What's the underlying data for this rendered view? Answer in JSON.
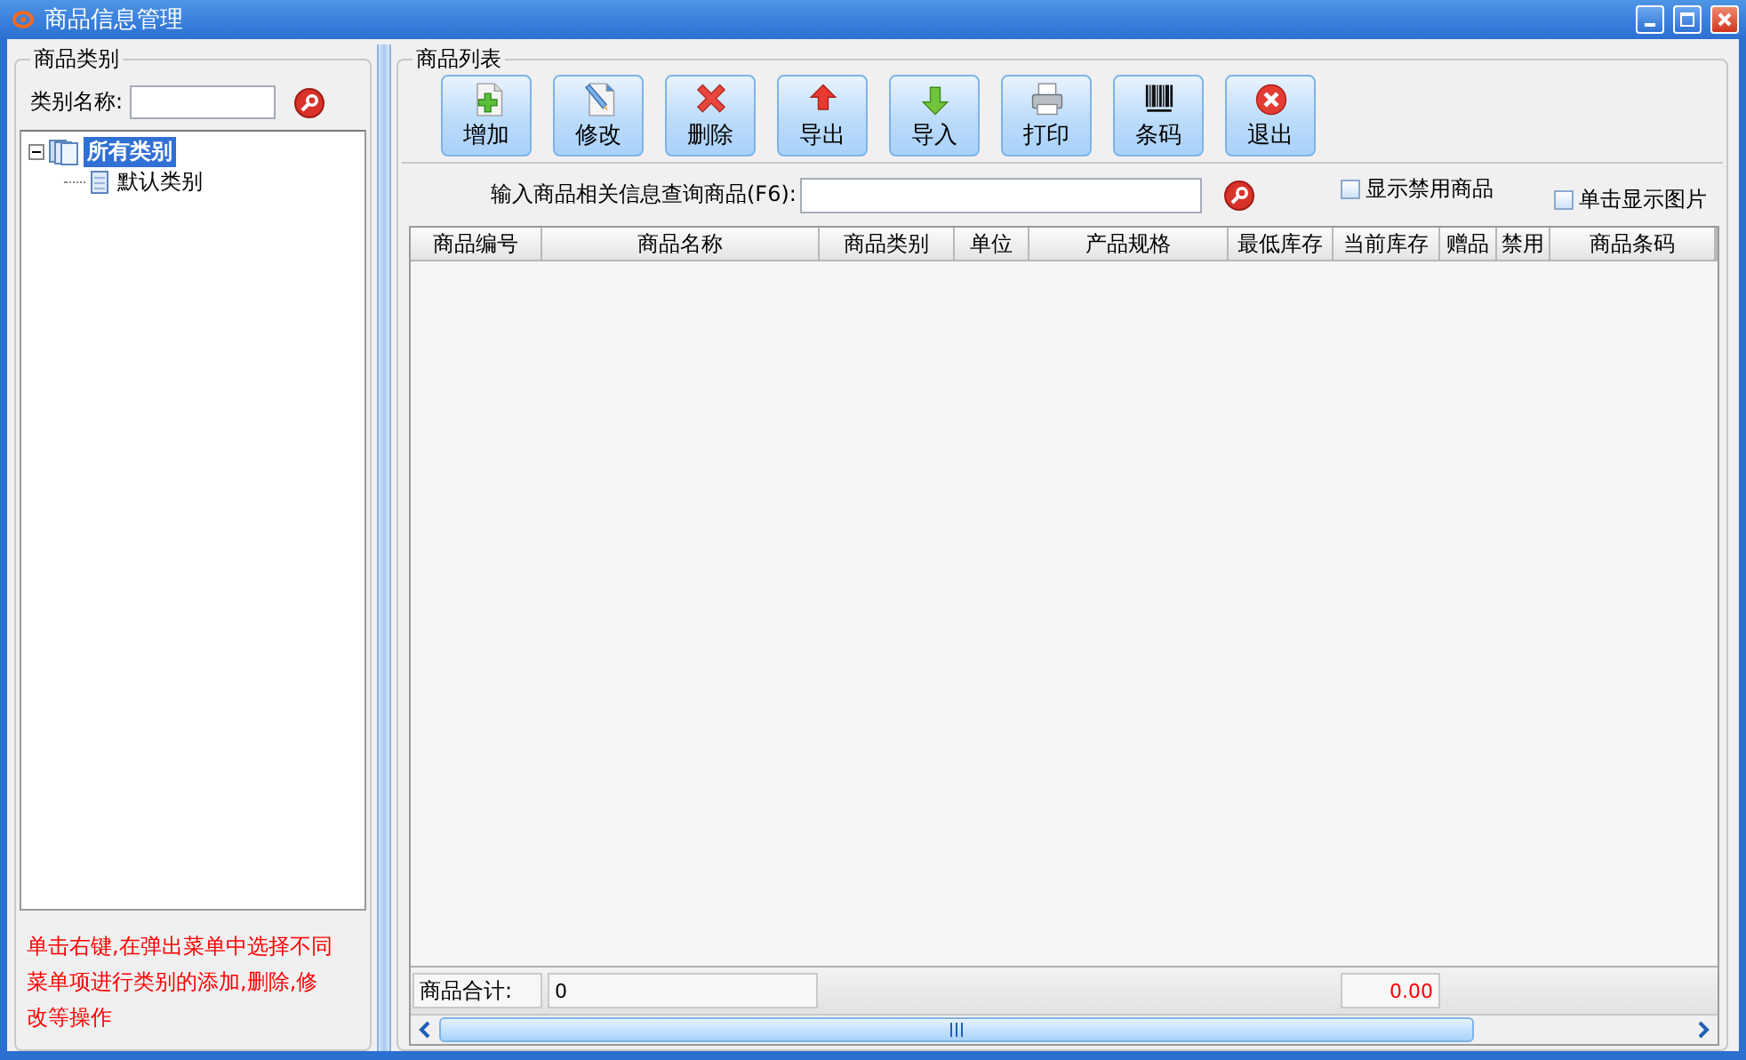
{
  "window": {
    "title": "商品信息管理"
  },
  "category_panel": {
    "title": "商品类别",
    "filter_label": "类别名称:",
    "tree": [
      {
        "label": "所有类别",
        "selected": true,
        "expanded": true,
        "children": [
          {
            "label": "默认类别",
            "selected": false
          }
        ]
      }
    ],
    "hint": "单击右键,在弹出菜单中选择不同菜单项进行类别的添加,删除,修改等操作"
  },
  "product_panel": {
    "title": "商品列表",
    "toolbar": [
      {
        "label": "增加",
        "kind": "add"
      },
      {
        "label": "修改",
        "kind": "edit"
      },
      {
        "label": "删除",
        "kind": "delete"
      },
      {
        "label": "导出",
        "kind": "export"
      },
      {
        "label": "导入",
        "kind": "import"
      },
      {
        "label": "打印",
        "kind": "print"
      },
      {
        "label": "条码",
        "kind": "barcode"
      },
      {
        "label": "退出",
        "kind": "exit"
      }
    ],
    "search_label": "输入商品相关信息查询商品(F6):",
    "options": [
      {
        "label": "显示禁用商品",
        "checked": false
      },
      {
        "label": "单击显示图片",
        "checked": false
      }
    ],
    "table": {
      "columns": [
        "商品编号",
        "商品名称",
        "商品类别",
        "单位",
        "产品规格",
        "最低库存",
        "当前库存",
        "赠品",
        "禁用",
        "商品条码"
      ]
    },
    "footer": {
      "count_label": "商品合计:",
      "count": "0",
      "total": "0.00"
    }
  }
}
